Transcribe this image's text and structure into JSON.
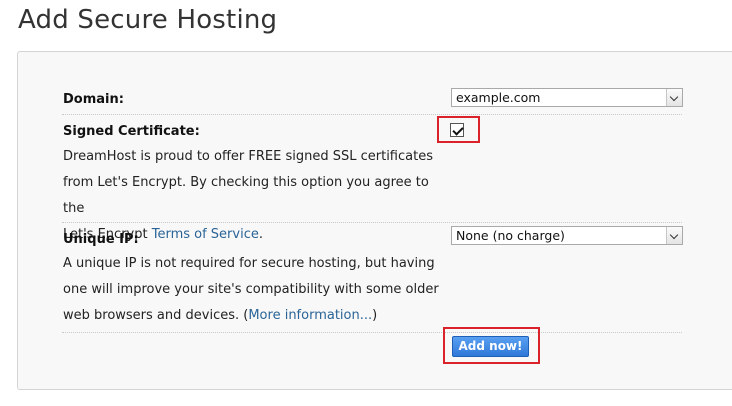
{
  "page": {
    "title": "Add Secure Hosting"
  },
  "form": {
    "domain": {
      "label": "Domain:",
      "selected": "example.com"
    },
    "signed_certificate": {
      "label": "Signed Certificate:",
      "checked": true,
      "description_line1": "DreamHost is proud to offer FREE signed SSL certificates",
      "description_line2": "from Let's Encrypt. By checking this option you agree to the",
      "description_line3_prefix": "Let's Encrypt ",
      "terms_link": "Terms of Service",
      "description_line3_suffix": "."
    },
    "unique_ip": {
      "label": "Unique IP:",
      "selected": "None (no charge)",
      "description_line1": "A unique IP is not required for secure hosting, but having",
      "description_line2": "one will improve your site's compatibility with some older",
      "description_line3_prefix": "web browsers and devices. (",
      "more_info_link": "More information...",
      "description_line3_suffix": ")"
    },
    "submit_label": "Add now!"
  },
  "colors": {
    "highlight": "#d9222a",
    "button": "#2f78d8",
    "link": "#2a6496"
  }
}
